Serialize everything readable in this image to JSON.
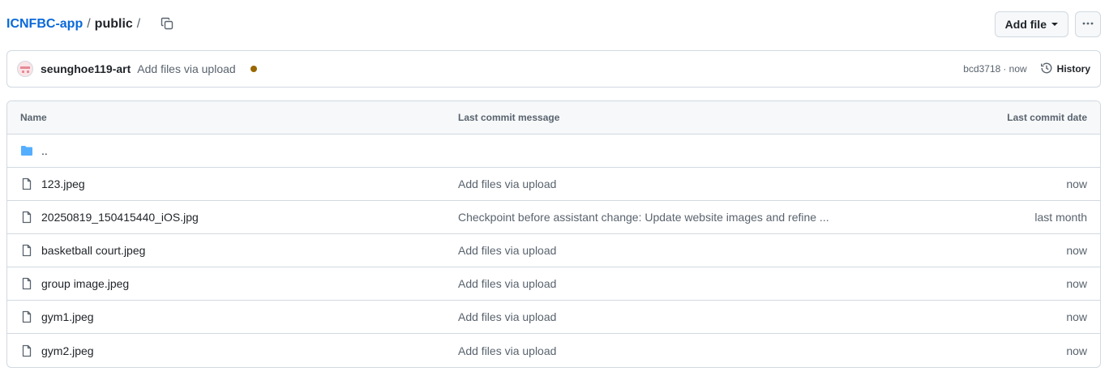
{
  "breadcrumb": {
    "repo": "ICNFBC-app",
    "separator": "/",
    "dir": "public",
    "trailing": "/"
  },
  "toolbar": {
    "add_file_label": "Add file",
    "more_label": "···"
  },
  "commit": {
    "author": "seunghoe119-art",
    "message": "Add files via upload",
    "status_color": "#9a6700",
    "sha": "bcd3718",
    "time": "· now",
    "history_label": "History"
  },
  "table": {
    "headers": {
      "name": "Name",
      "message": "Last commit message",
      "date": "Last commit date"
    },
    "parent_dir": "..",
    "rows": [
      {
        "name": "123.jpeg",
        "message": "Add files via upload",
        "date": "now"
      },
      {
        "name": "20250819_150415440_iOS.jpg",
        "message": "Checkpoint before assistant change: Update website images and refine ...",
        "date": "last month"
      },
      {
        "name": "basketball court.jpeg",
        "message": "Add files via upload",
        "date": "now"
      },
      {
        "name": "group image.jpeg",
        "message": "Add files via upload",
        "date": "now"
      },
      {
        "name": "gym1.jpeg",
        "message": "Add files via upload",
        "date": "now"
      },
      {
        "name": "gym2.jpeg",
        "message": "Add files via upload",
        "date": "now"
      }
    ]
  },
  "icons": {
    "copy": "copy-icon",
    "history": "history-icon",
    "folder": "folder-icon",
    "file": "file-icon"
  },
  "colors": {
    "link": "#0969da",
    "folder": "#54aeff",
    "muted": "#59636e",
    "border": "#d1d9e0"
  }
}
